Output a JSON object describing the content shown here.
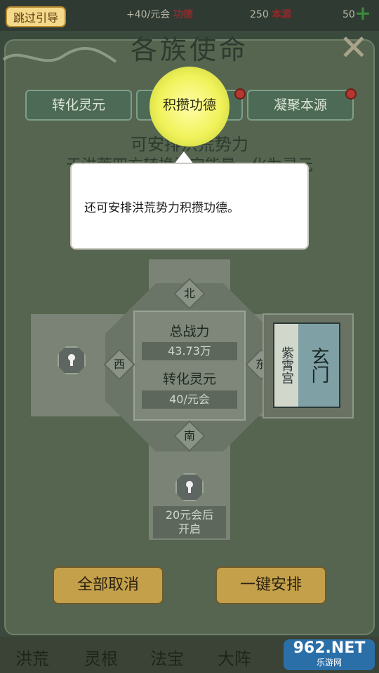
{
  "top_bar": {
    "skip_label": "跳过引导",
    "resources": [
      {
        "value": "+40/元会",
        "name": "功德"
      },
      {
        "value": "250",
        "name": "本源"
      },
      {
        "value": "50"
      }
    ]
  },
  "panel": {
    "title": "各族使命",
    "tabs": [
      {
        "label": "转化灵元",
        "has_dot": false
      },
      {
        "label": "积攒功德",
        "has_dot": true
      },
      {
        "label": "凝聚本源",
        "has_dot": true
      }
    ],
    "hint_line1": "可安排洪荒势力",
    "hint_line2": "于洪荒四方转换法宝能量，化为灵元"
  },
  "tooltip": {
    "text": "还可安排洪荒势力积攒功德。"
  },
  "map": {
    "directions": {
      "north": "北",
      "south": "南",
      "east": "东",
      "west": "西"
    },
    "center": {
      "power_label": "总战力",
      "power_value": "43.73万",
      "conversion_label": "转化灵元",
      "conversion_value": "40/元会"
    },
    "east_sect": {
      "sub": "紫霄宫",
      "name": "玄门"
    },
    "south_lock_text_1": "20元会后",
    "south_lock_text_2": "开启"
  },
  "actions": {
    "cancel_all": "全部取消",
    "one_click": "一键安排"
  },
  "bottom_nav": [
    "洪荒",
    "灵根",
    "法宝",
    "大阵"
  ],
  "watermark": {
    "main": "962.NET",
    "sub": "乐游网"
  },
  "colors": {
    "accent_gold": "#c4a04b",
    "highlight": "#f1f25a",
    "badge_red": "#b3382f"
  }
}
